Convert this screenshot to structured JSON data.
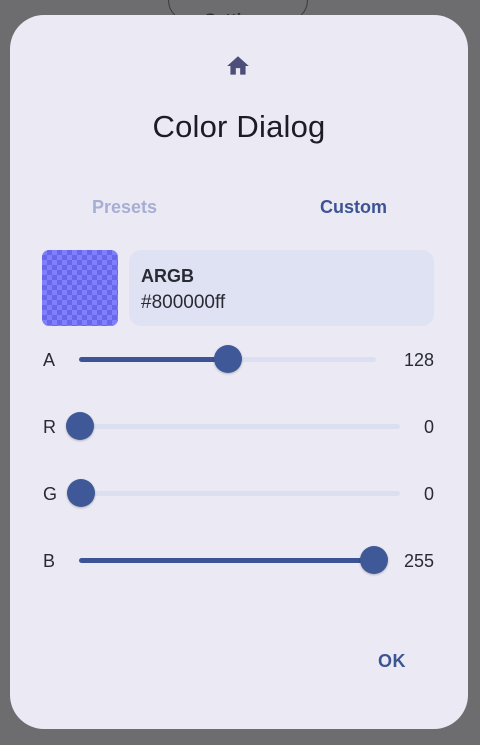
{
  "background": {
    "settings_button_label": "Settings"
  },
  "dialog": {
    "icon": "home-icon",
    "title": "Color Dialog",
    "tabs": [
      {
        "label": "Presets",
        "selected": false
      },
      {
        "label": "Custom",
        "selected": true
      }
    ],
    "preview": {
      "color": "#800000ff",
      "format_label": "ARGB",
      "value": "#800000ff"
    },
    "sliders": [
      {
        "channel": "A",
        "value": "128",
        "fraction": 0.502
      },
      {
        "channel": "R",
        "value": "0",
        "fraction": 0
      },
      {
        "channel": "G",
        "value": "0",
        "fraction": 0
      },
      {
        "channel": "B",
        "value": "255",
        "fraction": 1
      }
    ],
    "ok_label": "OK"
  },
  "colors": {
    "accent": "#3d5494",
    "dialog_bg": "#ebeaf4",
    "scrim": "#6d6d70",
    "tab_inactive": "#a7aed3"
  }
}
